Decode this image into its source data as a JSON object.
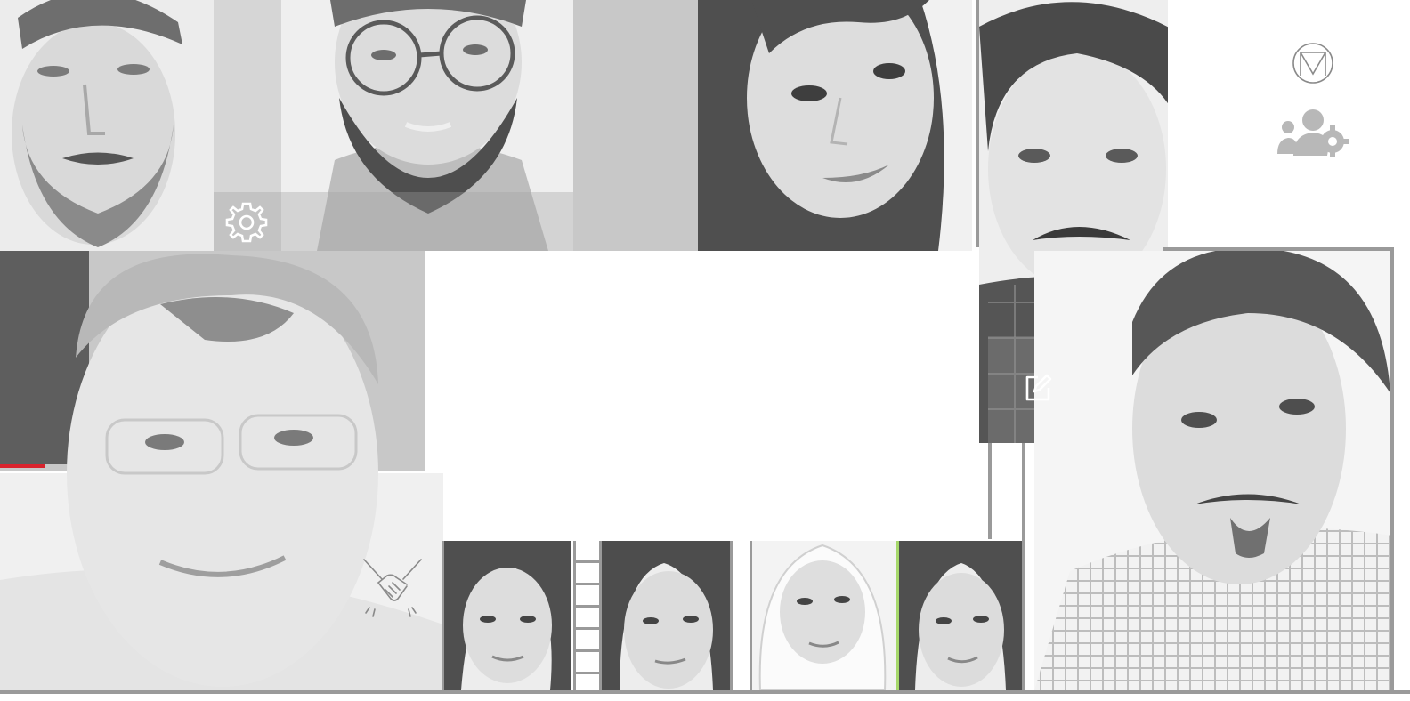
{
  "collage": {
    "tiles": [
      {
        "id": "portrait-1",
        "name": "man-short-beard"
      },
      {
        "id": "portrait-2",
        "name": "man-glasses-beard"
      },
      {
        "id": "portrait-3",
        "name": "woman-long-hair"
      },
      {
        "id": "portrait-4",
        "name": "man-mustache"
      },
      {
        "id": "portrait-5",
        "name": "man-rimless-glasses"
      },
      {
        "id": "portrait-6",
        "name": "man-checked-shirt"
      },
      {
        "id": "portrait-7",
        "name": "woman-1"
      },
      {
        "id": "portrait-8",
        "name": "woman-2"
      },
      {
        "id": "portrait-9",
        "name": "woman-hijab"
      },
      {
        "id": "portrait-10",
        "name": "woman-3"
      }
    ],
    "icons": [
      "gear-icon",
      "edit-icon",
      "handshake-icon",
      "monogram-m-icon",
      "users-settings-icon"
    ],
    "accent_colors": {
      "red": "#d9232d",
      "green": "#a6d86b",
      "gray": "#9a9a9a"
    }
  }
}
